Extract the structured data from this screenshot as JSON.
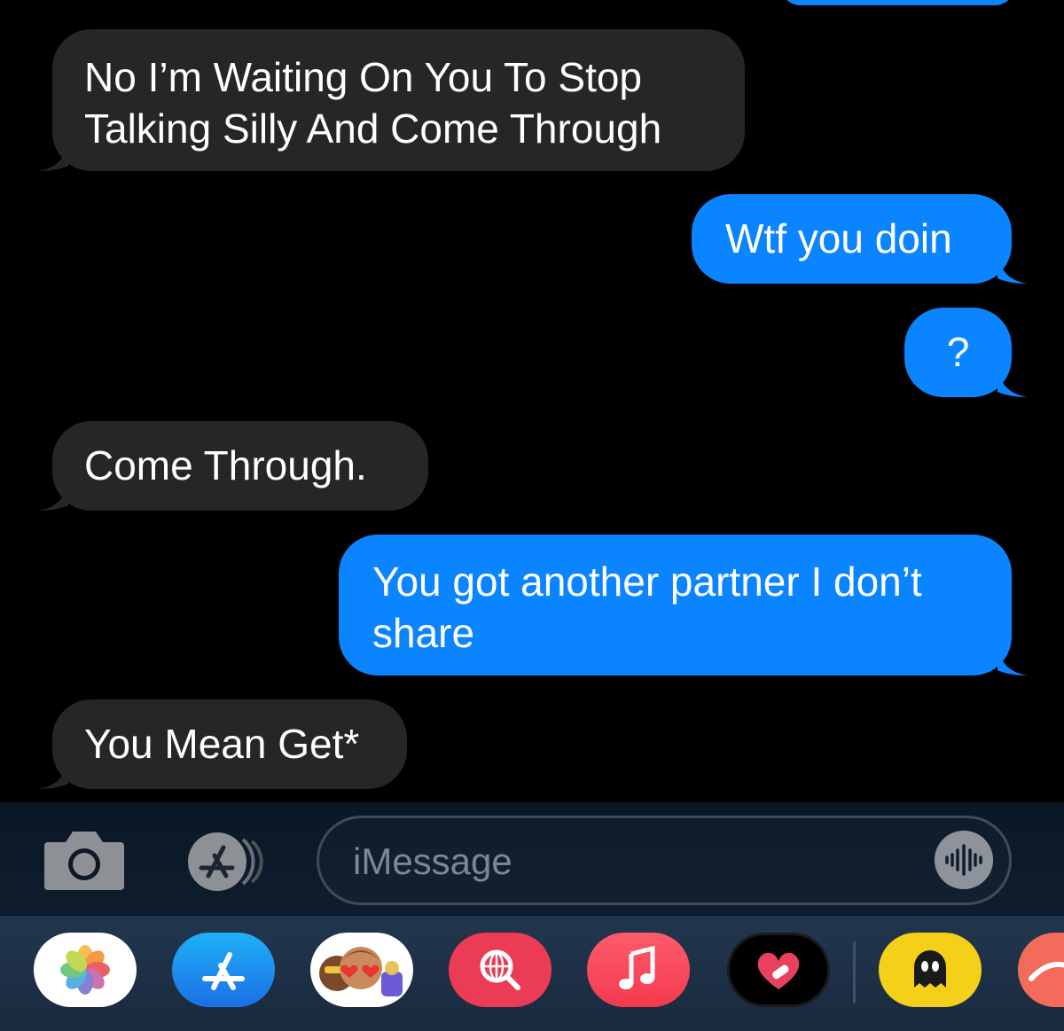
{
  "messages": [
    {
      "type": "received",
      "lines": [
        "No I’m Waiting On You To Stop",
        "Talking Silly And Come Through"
      ]
    },
    {
      "type": "sent",
      "lines": [
        "Wtf you doin"
      ]
    },
    {
      "type": "sent",
      "lines": [
        "?"
      ]
    },
    {
      "type": "received",
      "lines": [
        "Come Through."
      ]
    },
    {
      "type": "sent",
      "lines": [
        "You got another partner I don’t",
        "share"
      ]
    },
    {
      "type": "received",
      "lines": [
        "You Mean Get*"
      ]
    }
  ],
  "input": {
    "placeholder": "iMessage",
    "value": ""
  },
  "toolbar": {
    "camera_icon": "camera-icon",
    "appstore_icon": "app-store-icon",
    "audio_icon": "audio-waveform-icon"
  },
  "apps": [
    {
      "name": "photos-app-icon"
    },
    {
      "name": "app-store-app-icon"
    },
    {
      "name": "memoji-stickers-app-icon"
    },
    {
      "name": "image-search-app-icon"
    },
    {
      "name": "music-app-icon"
    },
    {
      "name": "heart-stickers-app-icon"
    },
    {
      "name": "ghost-app-icon"
    },
    {
      "name": "partial-app-icon"
    }
  ],
  "colors": {
    "sent": "#0a84ff",
    "received": "#262628",
    "background": "#000000"
  }
}
